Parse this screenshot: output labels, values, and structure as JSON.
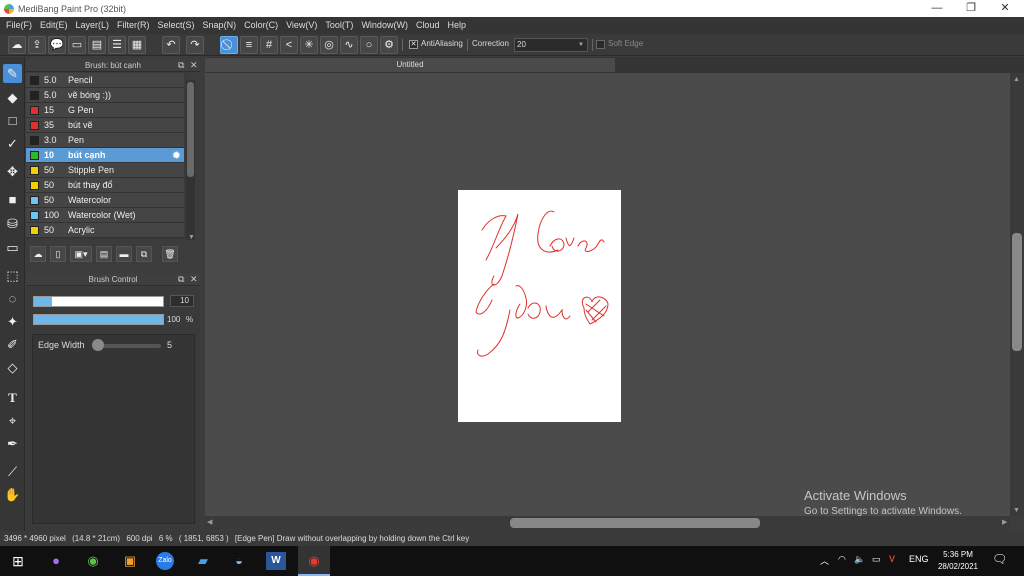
{
  "window": {
    "title": "MediBang Paint Pro (32bit)",
    "controls": [
      "—",
      "❐",
      "✕"
    ]
  },
  "menu": [
    "File(F)",
    "Edit(E)",
    "Layer(L)",
    "Filter(R)",
    "Select(S)",
    "Snap(N)",
    "Color(C)",
    "View(V)",
    "Tool(T)",
    "Window(W)",
    "Cloud",
    "Help"
  ],
  "toolbar": {
    "antialiasing_label": "AntiAliasing",
    "correction_label": "Correction",
    "correction_value": "20",
    "soft_edge_label": "Soft Edge"
  },
  "brush_panel": {
    "title": "Brush: bút cạnh",
    "brushes": [
      {
        "size": "5.0",
        "name": "Pencil",
        "color": "#222222"
      },
      {
        "size": "5.0",
        "name": "vẽ bóng :))",
        "color": "#222222"
      },
      {
        "size": "15",
        "name": "G Pen",
        "color": "#e03030"
      },
      {
        "size": "35",
        "name": "bút vẽ",
        "color": "#e03030"
      },
      {
        "size": "3.0",
        "name": "Pen",
        "color": "#222222"
      },
      {
        "size": "10",
        "name": "bút cạnh",
        "color": "#2db82d",
        "selected": true
      },
      {
        "size": "50",
        "name": "Stipple Pen",
        "color": "#f0d000"
      },
      {
        "size": "50",
        "name": "bút thay đổ",
        "color": "#f0d000"
      },
      {
        "size": "50",
        "name": "Watercolor",
        "color": "#6ec6f0"
      },
      {
        "size": "100",
        "name": "Watercolor (Wet)",
        "color": "#6ec6f0"
      },
      {
        "size": "50",
        "name": "Acrylic",
        "color": "#f0d000"
      }
    ]
  },
  "brush_control": {
    "title": "Brush Control",
    "size_value": "10",
    "size_fill": 0.14,
    "opacity_value": "100",
    "opacity_unit": "%",
    "opacity_fill": 1.0,
    "edge_width_label": "Edge Width",
    "edge_width_value": "5",
    "edge_width_fill": 0.0
  },
  "document": {
    "tab_title": "Untitled"
  },
  "watermark": {
    "line1": "Activate Windows",
    "line2": "Go to Settings to activate Windows."
  },
  "status": {
    "size": "3496 * 4960 pixel",
    "cm": "(14.8 * 21cm)",
    "dpi": "600 dpi",
    "zoom": "6 %",
    "coords": "( 1851, 6853 )",
    "hint": "[Edge Pen] Draw without overlapping by holding down the Ctrl key"
  },
  "taskbar": {
    "language": "ENG",
    "time": "5:36 PM",
    "date": "28/02/2021",
    "zalo_label": "Zalo"
  },
  "accent": "#4a90d9",
  "ink_color": "#e0302a"
}
